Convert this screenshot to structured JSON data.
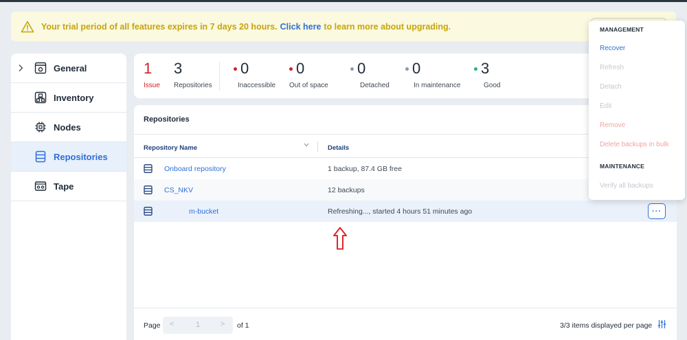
{
  "banner": {
    "text_before": "Your trial period of all features expires in 7 days 20 hours.",
    "link": "Click here",
    "text_after": "to learn more about upgrading."
  },
  "sidebar": {
    "items": [
      {
        "label": "General",
        "icon": "general-settings-icon"
      },
      {
        "label": "Inventory",
        "icon": "inventory-icon"
      },
      {
        "label": "Nodes",
        "icon": "nodes-chip-icon"
      },
      {
        "label": "Repositories",
        "icon": "repository-icon"
      },
      {
        "label": "Tape",
        "icon": "tape-icon"
      }
    ]
  },
  "stats": {
    "issue": {
      "value": "1",
      "label": "Issue"
    },
    "repositories": {
      "value": "3",
      "label": "Repositories"
    },
    "inaccessible": {
      "value": "0",
      "label": "Inaccessible"
    },
    "out_of_space": {
      "value": "0",
      "label": "Out of space"
    },
    "detached": {
      "value": "0",
      "label": "Detached"
    },
    "in_maintenance": {
      "value": "0",
      "label": "In maintenance"
    },
    "good": {
      "value": "3",
      "label": "Good"
    }
  },
  "main": {
    "title": "Repositories",
    "columns": {
      "name": "Repository Name",
      "details": "Details"
    },
    "rows": [
      {
        "name": "Onboard repository",
        "details": "1 backup, 87.4 GB free"
      },
      {
        "name": "CS_NKV",
        "details": "12 backups"
      },
      {
        "name": "m-bucket",
        "details": "Refreshing..., started 4 hours 51 minutes ago"
      }
    ],
    "more_label": "···"
  },
  "footer": {
    "page_label": "Page",
    "current_page": "1",
    "of_label": "of 1",
    "prev": "<",
    "next": ">",
    "items_per_page": "3/3 items displayed per page"
  },
  "menu": {
    "management_header": "MANAGEMENT",
    "maintenance_header": "MAINTENANCE",
    "items": {
      "recover": "Recover",
      "refresh": "Refresh",
      "detach": "Detach",
      "edit": "Edit",
      "remove": "Remove",
      "delete_bulk": "Delete backups in bulk",
      "verify_all": "Verify all backups"
    }
  },
  "colors": {
    "accent": "#2f6fd6",
    "issue": "#d0202b",
    "good": "#22b573",
    "neutral_dot": "#8b9ab0",
    "warning_text": "#c7a40e"
  }
}
